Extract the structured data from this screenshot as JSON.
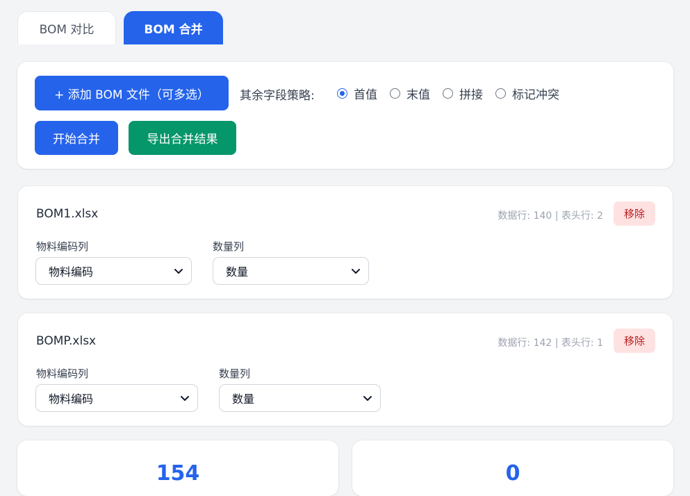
{
  "tabs": [
    {
      "label": "BOM 对比",
      "active": false
    },
    {
      "label": "BOM 合并",
      "active": true
    }
  ],
  "toolbar": {
    "add_label": "+ 添加 BOM 文件（可多选）",
    "strategy_label": "其余字段策略:",
    "strategy_options": [
      "首值",
      "末值",
      "拼接",
      "标记冲突"
    ],
    "strategy_selected": "首值",
    "start_label": "开始合并",
    "export_label": "导出合并结果"
  },
  "files": [
    {
      "name": "BOM1.xlsx",
      "meta": "数据行: 140 | 表头行: 2",
      "remove_label": "移除",
      "code_label": "物料编码列",
      "code_value": "物料编码",
      "qty_label": "数量列",
      "qty_value": "数量"
    },
    {
      "name": "BOMP.xlsx",
      "meta": "数据行: 142 | 表头行: 1",
      "remove_label": "移除",
      "code_label": "物料编码列",
      "code_value": "物料编码",
      "qty_label": "数量列",
      "qty_value": "数量"
    }
  ],
  "stats": [
    {
      "value": "154"
    },
    {
      "value": "0"
    }
  ],
  "colors": {
    "primary": "#2563eb",
    "success": "#059669",
    "danger_bg": "#fee2e2",
    "danger_text": "#b91c1c"
  }
}
